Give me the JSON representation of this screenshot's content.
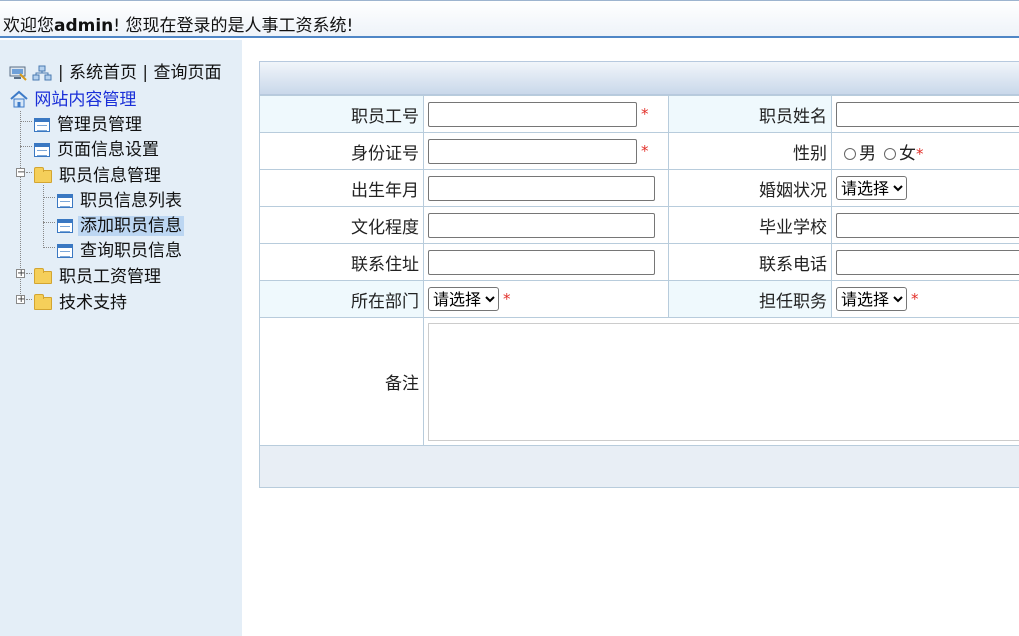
{
  "header": {
    "welcome_prefix": "欢迎您",
    "username": "admin",
    "welcome_suffix": "! 您现在登录的是人事工资系统!"
  },
  "sidebar": {
    "links": {
      "separator": "|",
      "home": "系统首页",
      "query": "查询页面"
    },
    "root": "网站内容管理",
    "items": [
      {
        "label": "管理员管理"
      },
      {
        "label": "页面信息设置"
      },
      {
        "label": "职员信息管理",
        "expanded": true,
        "children": [
          {
            "label": "职员信息列表"
          },
          {
            "label": "添加职员信息",
            "selected": true
          },
          {
            "label": "查询职员信息"
          }
        ]
      },
      {
        "label": "职员工资管理",
        "expanded": false
      },
      {
        "label": "技术支持",
        "expanded": false
      }
    ]
  },
  "form": {
    "required_mark": "*",
    "employee_id": {
      "label": "职员工号",
      "value": ""
    },
    "employee_name": {
      "label": "职员姓名",
      "value": ""
    },
    "id_card": {
      "label": "身份证号",
      "value": ""
    },
    "gender": {
      "label": "性别",
      "options": [
        "男",
        "女"
      ]
    },
    "birth": {
      "label": "出生年月",
      "value": ""
    },
    "marital": {
      "label": "婚姻状况",
      "selected": "请选择"
    },
    "education": {
      "label": "文化程度",
      "value": ""
    },
    "school": {
      "label": "毕业学校",
      "value": ""
    },
    "address": {
      "label": "联系住址",
      "value": ""
    },
    "phone": {
      "label": "联系电话",
      "value": ""
    },
    "department": {
      "label": "所在部门",
      "selected": "请选择"
    },
    "position": {
      "label": "担任职务",
      "selected": "请选择"
    },
    "remark": {
      "label": "备注",
      "value": ""
    }
  },
  "colors": {
    "accent_border": "#4f86c6",
    "sidebar_bg": "#e4eef7",
    "required": "#e2302a",
    "link": "#1a2fd8"
  },
  "icons": {
    "toplinks": [
      "computer-icon",
      "network-icon"
    ],
    "root": "home-icon",
    "page": "page-icon",
    "folder": "folder-icon"
  }
}
